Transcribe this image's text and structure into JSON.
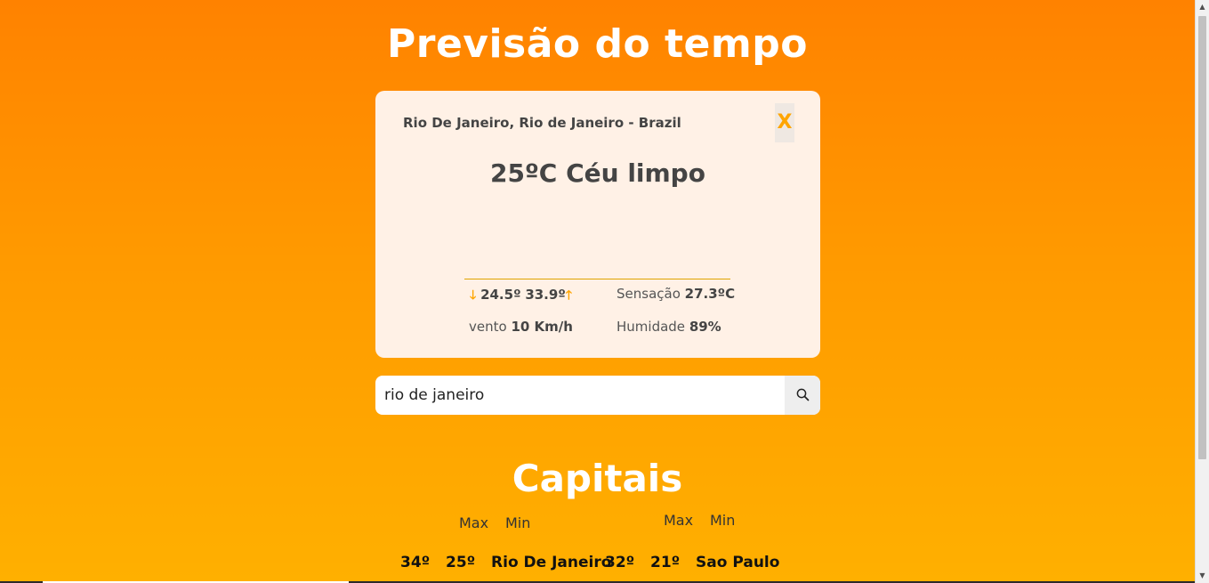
{
  "page": {
    "title": "Previsão do tempo"
  },
  "weather_card": {
    "location": "Rio De Janeiro, Rio de Janeiro - Brazil",
    "close_label": "X",
    "temperature": "25ºC",
    "description": "Céu limpo",
    "icon": "moon-icon",
    "min_temp": "24.5º",
    "max_temp": "33.9º",
    "feels_like_label": "Sensação",
    "feels_like_value": "27.3ºC",
    "wind_label": "vento",
    "wind_value": "10 Km/h",
    "humidity_label": "Humidade",
    "humidity_value": "89%"
  },
  "search": {
    "value": "rio de janeiro",
    "icon": "search-icon"
  },
  "capitals": {
    "title": "Capitais",
    "headers": {
      "max": "Max",
      "min": "Min"
    },
    "rows": [
      {
        "max": "34º",
        "min": "25º",
        "city": "Rio De Janeiro"
      },
      {
        "max": "32º",
        "min": "21º",
        "city": "Sao Paulo"
      }
    ]
  },
  "colors": {
    "background_top": "#ff8200",
    "background_bottom": "#ffb000",
    "card_background": "#fff1e6",
    "accent": "#ffa500"
  }
}
